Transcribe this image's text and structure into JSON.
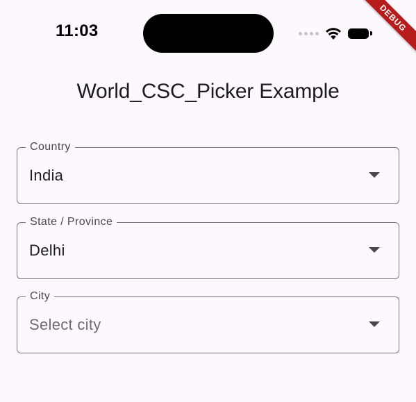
{
  "status_bar": {
    "time": "11:03"
  },
  "debug_banner": {
    "label": "DEBUG",
    "color": "#b71c1c"
  },
  "app": {
    "title": "World_CSC_Picker Example"
  },
  "fields": [
    {
      "label": "Country",
      "value": "India",
      "is_placeholder": false,
      "icon": "arrow-drop-down-icon"
    },
    {
      "label": "State / Province",
      "value": "Delhi",
      "is_placeholder": false,
      "icon": "arrow-drop-down-icon"
    },
    {
      "label": "City",
      "value": "Select city",
      "is_placeholder": true,
      "icon": "arrow-drop-down-icon"
    }
  ],
  "colors": {
    "background": "#fdf8fd",
    "outline": "#79747e",
    "label": "#49454f",
    "placeholder": "#6f6a74"
  }
}
